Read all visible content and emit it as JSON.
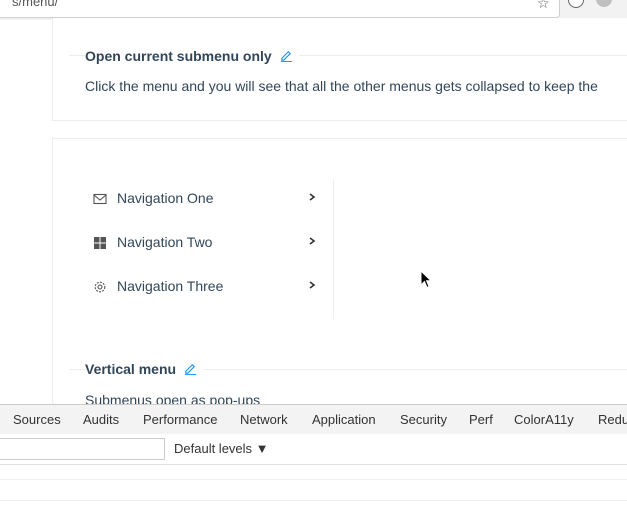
{
  "browser": {
    "url_fragment": "s/menu/",
    "icons": [
      "star-icon",
      "extension-icon",
      "profile-icon"
    ]
  },
  "section_current_submenu": {
    "title": "Open current submenu only",
    "description": "Click the menu and you will see that all the other menus gets collapsed to keep the"
  },
  "menu": {
    "items": [
      {
        "label": "Navigation One",
        "icon": "mail-icon"
      },
      {
        "label": "Navigation Two",
        "icon": "appstore-icon"
      },
      {
        "label": "Navigation Three",
        "icon": "setting-icon"
      }
    ]
  },
  "section_vertical_menu": {
    "title": "Vertical menu",
    "description": "Submenus open as pop-ups"
  },
  "devtools": {
    "tabs": [
      "Sources",
      "Audits",
      "Performance",
      "Network",
      "Application",
      "Security",
      "Perf",
      "ColorA11y",
      "Redu"
    ],
    "levels_label": "Default levels ▼"
  },
  "colors": {
    "text": "#314659",
    "border": "#ebedf0",
    "devtools_bg": "#f3f3f3"
  }
}
